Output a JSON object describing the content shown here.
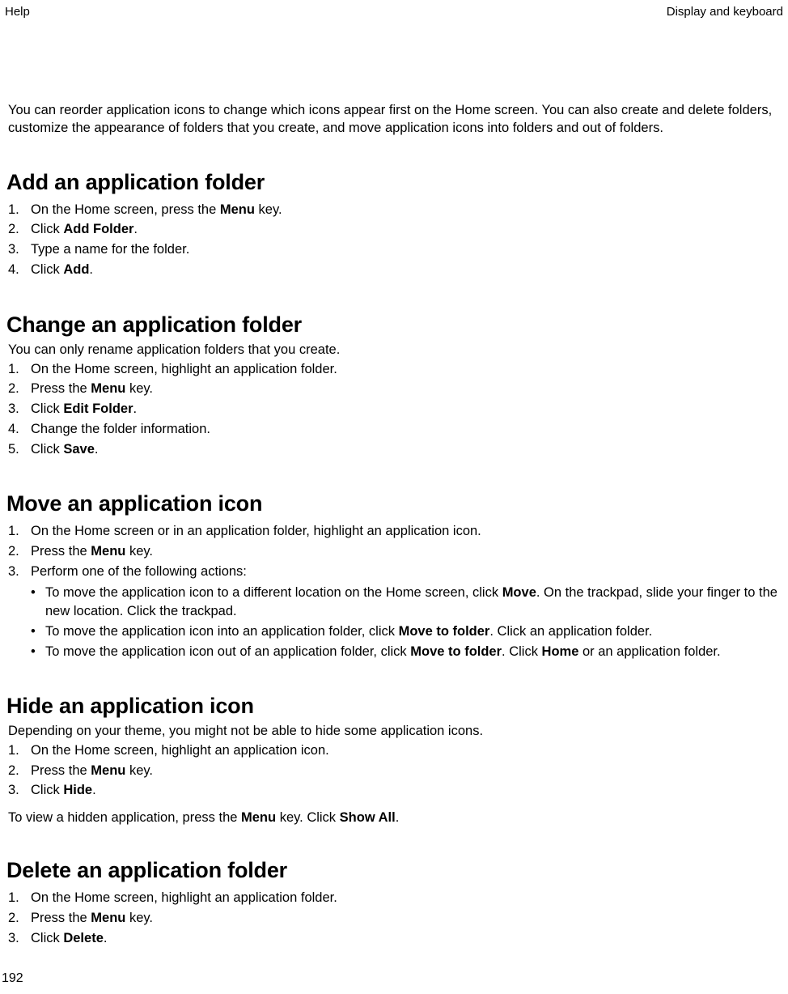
{
  "header": {
    "left": "Help",
    "right": "Display and keyboard"
  },
  "intro": "You can reorder application icons to change which icons appear first on the Home screen. You can also create and delete folders, customize the appearance of folders that you create, and move application icons into folders and out of folders.",
  "sections": {
    "add": {
      "title": "Add an application folder",
      "steps": [
        {
          "num": "1.",
          "pre": "On the Home screen, press the ",
          "bold": "Menu",
          "post": " key."
        },
        {
          "num": "2.",
          "pre": "Click ",
          "bold": "Add Folder",
          "post": "."
        },
        {
          "num": "3.",
          "plain": "Type a name for the folder."
        },
        {
          "num": "4.",
          "pre": "Click ",
          "bold": "Add",
          "post": "."
        }
      ]
    },
    "change": {
      "title": "Change an application folder",
      "note": "You can only rename application folders that you create.",
      "steps": [
        {
          "num": "1.",
          "plain": "On the Home screen, highlight an application folder."
        },
        {
          "num": "2.",
          "pre": "Press the ",
          "bold": "Menu",
          "post": " key."
        },
        {
          "num": "3.",
          "pre": "Click ",
          "bold": "Edit Folder",
          "post": "."
        },
        {
          "num": "4.",
          "plain": "Change the folder information."
        },
        {
          "num": "5.",
          "pre": "Click ",
          "bold": "Save",
          "post": "."
        }
      ]
    },
    "move": {
      "title": "Move an application icon",
      "steps": [
        {
          "num": "1.",
          "plain": "On the Home screen or in an application folder, highlight an application icon."
        },
        {
          "num": "2.",
          "pre": "Press the ",
          "bold": "Menu",
          "post": " key."
        },
        {
          "num": "3.",
          "plain": "Perform one of the following actions:"
        }
      ],
      "bullets": [
        {
          "pre": "To move the application icon to a different location on the Home screen, click ",
          "bold": "Move",
          "post": ". On the trackpad, slide your finger to the new location. Click the trackpad."
        },
        {
          "pre": "To move the application icon into an application folder, click ",
          "bold": "Move to folder",
          "post": ". Click an application folder."
        },
        {
          "pre": "To move the application icon out of an application folder, click ",
          "bold1": "Move to folder",
          "mid": ". Click ",
          "bold2": "Home",
          "post": " or an application folder."
        }
      ]
    },
    "hide": {
      "title": "Hide an application icon",
      "note": "Depending on your theme, you might not be able to hide some application icons.",
      "steps": [
        {
          "num": "1.",
          "plain": "On the Home screen, highlight an application icon."
        },
        {
          "num": "2.",
          "pre": "Press the ",
          "bold": "Menu",
          "post": " key."
        },
        {
          "num": "3.",
          "pre": "Click ",
          "bold": "Hide",
          "post": "."
        }
      ],
      "closing": {
        "pre": "To view a hidden application, press the ",
        "bold1": "Menu",
        "mid": " key. Click ",
        "bold2": "Show All",
        "post": "."
      }
    },
    "delete": {
      "title": "Delete an application folder",
      "steps": [
        {
          "num": "1.",
          "plain": "On the Home screen, highlight an application folder."
        },
        {
          "num": "2.",
          "pre": "Press the ",
          "bold": "Menu",
          "post": " key."
        },
        {
          "num": "3.",
          "pre": "Click ",
          "bold": "Delete",
          "post": "."
        }
      ]
    }
  },
  "page_number": "192"
}
